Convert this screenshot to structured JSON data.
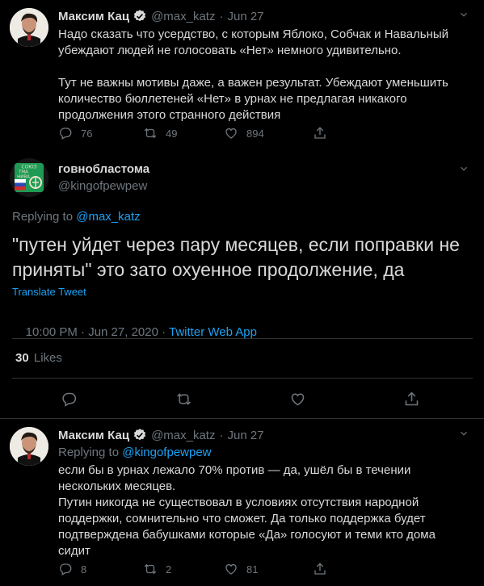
{
  "tweet1": {
    "name": "Максим Кац",
    "handle": "@max_katz",
    "dot": "·",
    "date": "Jun 27",
    "text": "Надо сказать что усердство, с которым Яблоко, Собчак и Навальный убеждают людей не голосовать «Нет» немного удивительно.\n\nТут не важны мотивы даже, а важен результат. Убеждают уменьшить количество бюллетеней «Нет» в урнах не предлагая никакого продолжения этого странного действия",
    "replies": "76",
    "retweets": "49",
    "likes": "894"
  },
  "main": {
    "name": "говнобластома",
    "handle": "@kingofpewpew",
    "replying_prefix": "Replying to ",
    "replying_to": "@max_katz",
    "text": "\"путен уйдет через пару месяцев, если поправки не приняты\" это зато охуенное продолжение, да",
    "translate": "Translate Tweet",
    "timestamp": "10:00 PM · Jun 27, 2020 · ",
    "source": "Twitter Web App",
    "likes_count": "30",
    "likes_label": "Likes"
  },
  "tweet3": {
    "name": "Максим Кац",
    "handle": "@max_katz",
    "dot": "·",
    "date": "Jun 27",
    "replying_prefix": "Replying to ",
    "replying_to": "@kingofpewpew",
    "text": "если бы в урнах лежало 70% против — да, ушёл бы в течении нескольких месяцев.\nПутин никогда не существовал в условиях отсутствия народной поддержки, сомнительно что сможет. Да только поддержка будет подтверждена бабушками которые «Да» голосуют и теми кто дома сидит",
    "replies": "8",
    "retweets": "2",
    "likes": "81"
  },
  "avatar_badge": {
    "line1": "СОЮЗ",
    "line2": "ТМА",
    "line3": "НИВА"
  },
  "colors": {
    "background": "#000000",
    "text": "#d9d9d9",
    "muted": "#6e767d",
    "accent": "#1da1f2",
    "divider": "#2f3336"
  }
}
